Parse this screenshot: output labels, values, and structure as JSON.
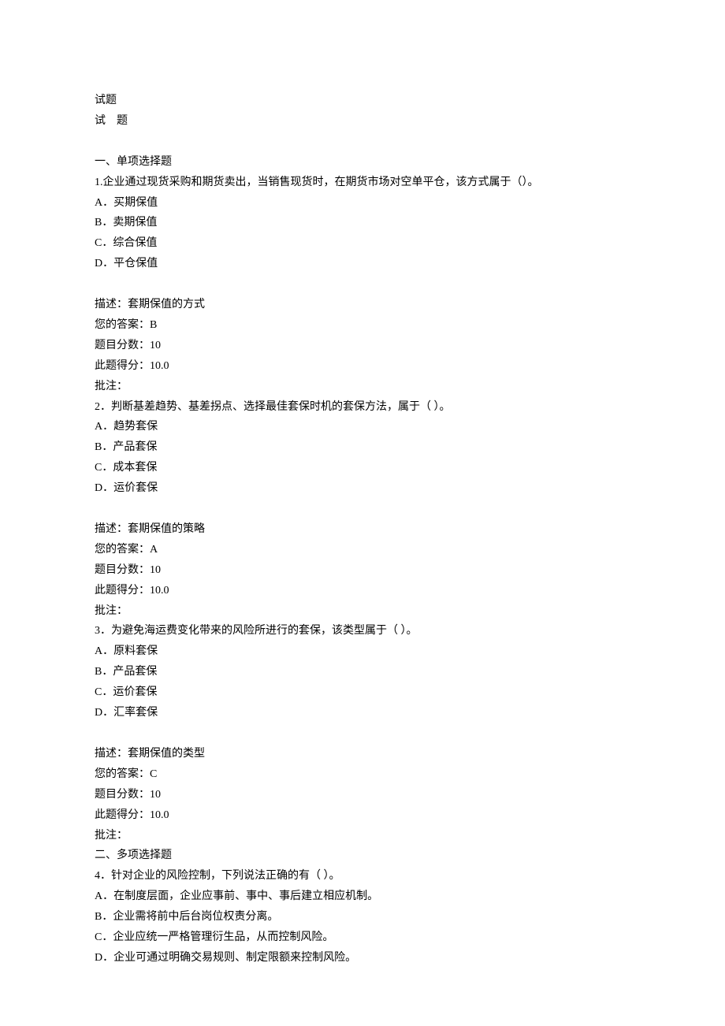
{
  "header": {
    "title_compact": "试题",
    "title_spaced": "试　题"
  },
  "section1": {
    "heading": "一、单项选择题",
    "q1": {
      "stem": "1.企业通过现货采购和期货卖出，当销售现货时，在期货市场对空单平仓，该方式属于（）。",
      "optA": "A．买期保值",
      "optB": "B．卖期保值",
      "optC": "C．综合保值",
      "optD": "D．平仓保值",
      "desc": "描述：套期保值的方式",
      "your_answer": "您的答案：B",
      "full_score": "题目分数：10",
      "your_score": "此题得分：10.0",
      "remark": "批注："
    },
    "q2": {
      "stem": "2．判断基差趋势、基差拐点、选择最佳套保时机的套保方法，属于（ ）。",
      "optA": "A．趋势套保",
      "optB": "B．产品套保",
      "optC": "C．成本套保",
      "optD": "D．运价套保",
      "desc": "描述：套期保值的策略",
      "your_answer": "您的答案：A",
      "full_score": "题目分数：10",
      "your_score": "此题得分：10.0",
      "remark": "批注："
    },
    "q3": {
      "stem": "3．为避免海运费变化带来的风险所进行的套保，该类型属于（ ）。",
      "optA": "A．原料套保",
      "optB": "B．产品套保",
      "optC": "C．运价套保",
      "optD": "D．汇率套保",
      "desc": "描述：套期保值的类型",
      "your_answer": "您的答案：C",
      "full_score": "题目分数：10",
      "your_score": "此题得分：10.0",
      "remark": "批注："
    }
  },
  "section2": {
    "heading": "二、多项选择题",
    "q4": {
      "stem": "4．针对企业的风险控制，下列说法正确的有（ ）。",
      "optA": "A．在制度层面，企业应事前、事中、事后建立相应机制。",
      "optB": "B．企业需将前中后台岗位权责分离。",
      "optC": "C．企业应统一严格管理衍生品，从而控制风险。",
      "optD": "D．企业可通过明确交易规则、制定限额来控制风险。"
    }
  }
}
